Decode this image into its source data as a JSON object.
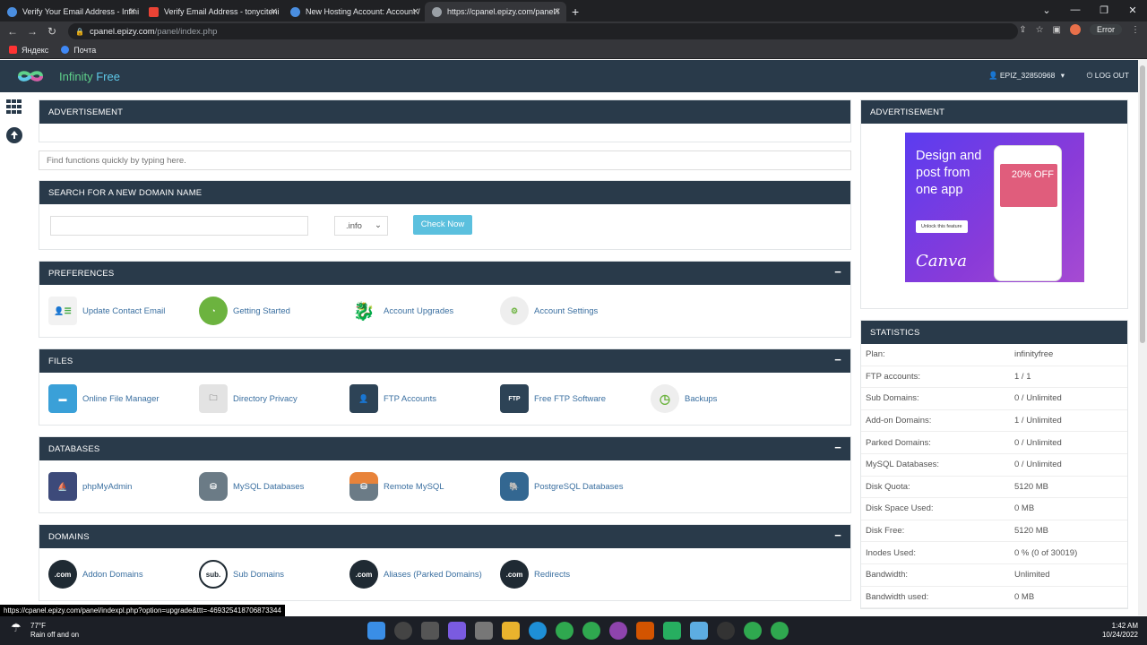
{
  "browser": {
    "tabs": [
      {
        "title": "Verify Your Email Address - Infini",
        "active": false
      },
      {
        "title": "Verify Email Address - tonyciteni",
        "active": false
      },
      {
        "title": "New Hosting Account: Account /",
        "active": false
      },
      {
        "title": "https://cpanel.epizy.com/panel/i",
        "active": true
      }
    ],
    "new_tab": "+",
    "url_host": "cpanel.epizy.com",
    "url_path": "/panel/index.php",
    "error_label": "Error",
    "bookmarks": [
      "Яндекс",
      "Почта"
    ]
  },
  "header": {
    "logo_word1": "Infinity",
    "logo_word2": "Free",
    "user": "EPIZ_32850968",
    "logout": "LOG OUT"
  },
  "ad_main": {
    "title": "ADVERTISEMENT"
  },
  "search": {
    "placeholder": "Find functions quickly by typing here."
  },
  "domain_search": {
    "title": "SEARCH FOR A NEW DOMAIN NAME",
    "tld": ".info",
    "button": "Check Now"
  },
  "sections": {
    "preferences": {
      "title": "PREFERENCES",
      "items": [
        "Update Contact Email",
        "Getting Started",
        "Account Upgrades",
        "Account Settings"
      ]
    },
    "files": {
      "title": "FILES",
      "items": [
        "Online File Manager",
        "Directory Privacy",
        "FTP Accounts",
        "Free FTP Software",
        "Backups"
      ]
    },
    "databases": {
      "title": "DATABASES",
      "items": [
        "phpMyAdmin",
        "MySQL Databases",
        "Remote MySQL",
        "PostgreSQL Databases"
      ]
    },
    "domains": {
      "title": "DOMAINS",
      "items": [
        "Addon Domains",
        "Sub Domains",
        "Aliases (Parked Domains)",
        "Redirects"
      ]
    }
  },
  "side_ad": {
    "title": "ADVERTISEMENT",
    "headline": "Design and post from one app",
    "button": "Unlock this feature",
    "brand": "Canva",
    "promo": "20% OFF"
  },
  "statistics": {
    "title": "STATISTICS",
    "rows": [
      {
        "k": "Plan:",
        "v": "infinityfree"
      },
      {
        "k": "FTP accounts:",
        "v": "1 / 1"
      },
      {
        "k": "Sub Domains:",
        "v": "0 / Unlimited"
      },
      {
        "k": "Add-on Domains:",
        "v": "1 / Unlimited"
      },
      {
        "k": "Parked Domains:",
        "v": "0 / Unlimited"
      },
      {
        "k": "MySQL Databases:",
        "v": "0 / Unlimited"
      },
      {
        "k": "Disk Quota:",
        "v": "5120 MB"
      },
      {
        "k": "Disk Space Used:",
        "v": "0 MB"
      },
      {
        "k": "Disk Free:",
        "v": "5120 MB"
      },
      {
        "k": "Inodes Used:",
        "v": "0 % (0 of 30019)"
      },
      {
        "k": "Bandwidth:",
        "v": "Unlimited"
      },
      {
        "k": "Bandwidth used:",
        "v": "0 MB"
      }
    ]
  },
  "status_url": "https://cpanel.epizy.com/panel/indexpl.php?option=upgrade&ttt=-469325418706873344",
  "taskbar": {
    "temp": "77°F",
    "weather": "Rain off and on",
    "time": "1:42 AM",
    "date": "10/24/2022"
  }
}
